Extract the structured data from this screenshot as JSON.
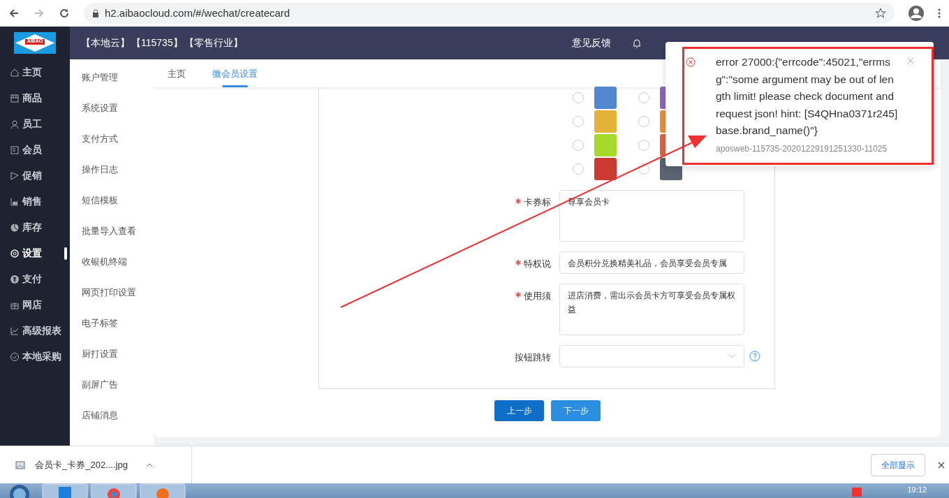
{
  "browser": {
    "url": "h2.aibaocloud.com/#/wechat/createcard"
  },
  "header": {
    "logo": "AIBAO",
    "tags": [
      "【本地云】",
      "【115735】",
      "【零售行业】"
    ],
    "feedback": "意见反馈"
  },
  "sidebar": {
    "items": [
      {
        "label": "主页",
        "selected": false
      },
      {
        "label": "商品",
        "selected": false
      },
      {
        "label": "员工",
        "selected": false
      },
      {
        "label": "会员",
        "selected": false
      },
      {
        "label": "促销",
        "selected": false
      },
      {
        "label": "销售",
        "selected": false
      },
      {
        "label": "库存",
        "selected": false
      },
      {
        "label": "设置",
        "selected": true
      },
      {
        "label": "支付",
        "selected": false
      },
      {
        "label": "网店",
        "selected": false
      },
      {
        "label": "高级报表",
        "selected": false
      },
      {
        "label": "本地采购",
        "selected": false
      }
    ]
  },
  "submenu": [
    "账户管理",
    "系统设置",
    "支付方式",
    "操作日志",
    "短信模板",
    "批量导入查看",
    "收银机终端",
    "网页打印设置",
    "电子标签",
    "厨打设置",
    "副屏广告",
    "店铺消息"
  ],
  "tabs": [
    {
      "label": "主页",
      "selected": false
    },
    {
      "label": "微会员设置",
      "selected": true
    }
  ],
  "colors": [
    {
      "color": "#5387d1",
      "selected": false
    },
    {
      "color": "#8f63bf",
      "selected": false
    },
    {
      "color": "#e4b239",
      "selected": false
    },
    {
      "color": "#ec903c",
      "selected": false
    },
    {
      "color": "#a7d92a",
      "selected": false
    },
    {
      "color": "#dd6548",
      "selected": false
    },
    {
      "color": "#cb3b31",
      "selected": false
    },
    {
      "color": "#5b6270",
      "selected": false
    }
  ],
  "fields": [
    {
      "label": "卡券标",
      "required": true,
      "value": "尊享会员卡",
      "kind": "textarea"
    },
    {
      "label": "特权说",
      "required": true,
      "value": "会员积分兑换精美礼品，会员享受会员专属",
      "kind": "short"
    },
    {
      "label": "使用须",
      "required": true,
      "value": "进店消费，需出示会员卡方可享受会员专属权益",
      "kind": "textarea"
    },
    {
      "label": "按钮跳转",
      "required": false,
      "kind": "select"
    }
  ],
  "buttons": [
    {
      "label": "上一步",
      "kind": "primary"
    },
    {
      "label": "下一步",
      "kind": "secondary"
    }
  ],
  "toast": {
    "message": "error 27000:{\"errcode\":45021,\"errmsg\":\"some argument may be out of length limit! please check document and request json! hint: [S4QHna0371r245] base.brand_name()\"}",
    "trace": "aposweb-115735-20201229191251330-11025"
  },
  "download": {
    "file": "会员卡_卡券_202....jpg",
    "show_all": "全部显示"
  },
  "taskbar": {
    "time": "19:12"
  }
}
